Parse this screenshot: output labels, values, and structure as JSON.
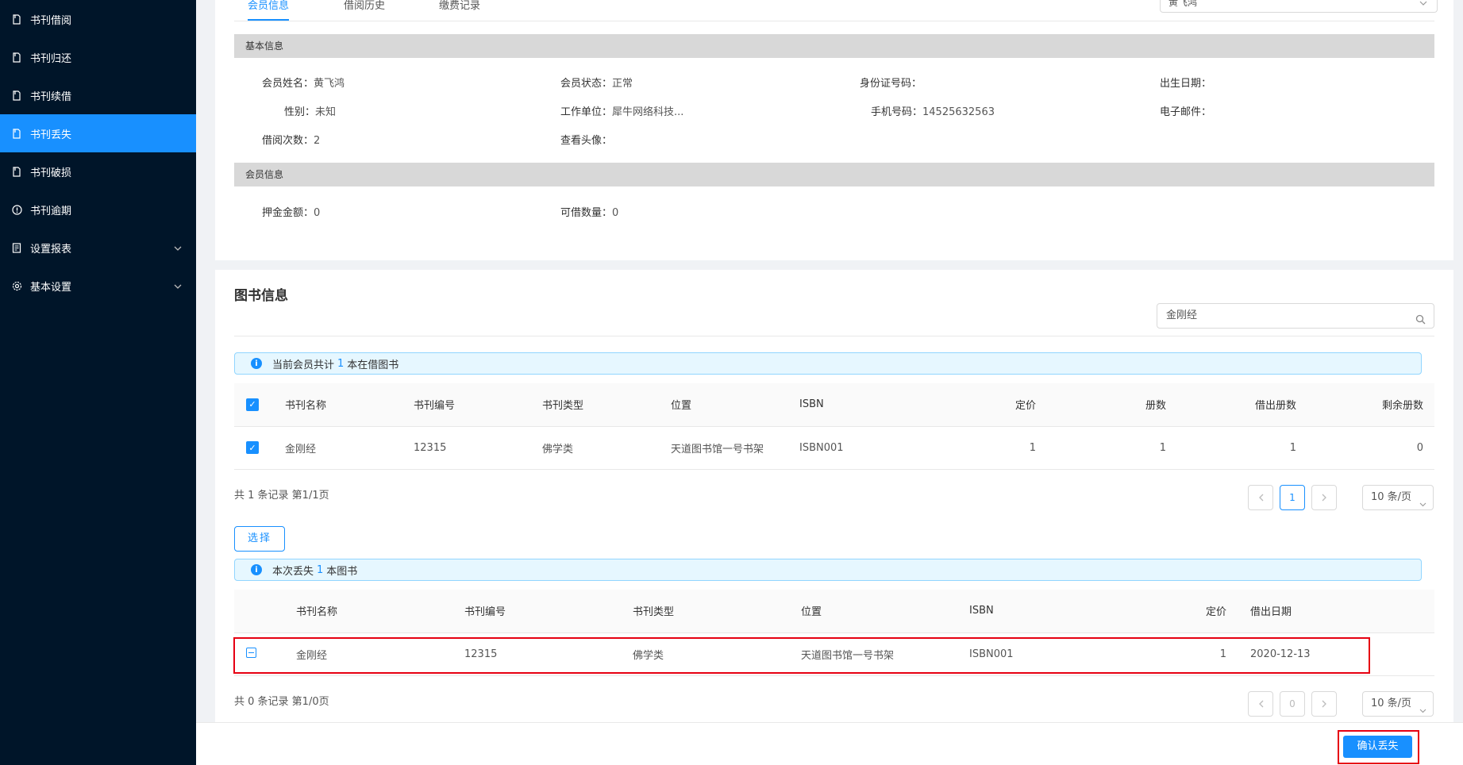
{
  "sidebar": {
    "items": [
      {
        "label": "书刊借阅",
        "icon": "file-icon"
      },
      {
        "label": "书刊归还",
        "icon": "file-icon"
      },
      {
        "label": "书刊续借",
        "icon": "file-icon"
      },
      {
        "label": "书刊丢失",
        "icon": "file-icon",
        "active": true
      },
      {
        "label": "书刊破损",
        "icon": "file-icon"
      },
      {
        "label": "书刊逾期",
        "icon": "exclamation-circle-icon"
      },
      {
        "label": "设置报表",
        "icon": "report-icon",
        "expandable": true
      },
      {
        "label": "基本设置",
        "icon": "gear-icon",
        "expandable": true
      }
    ]
  },
  "tabs": [
    "会员信息",
    "借阅历史",
    "缴费记录"
  ],
  "member_select": {
    "value": "黄飞鸿"
  },
  "basic_info": {
    "title": "基本信息",
    "name_label": "会员姓名：",
    "name": "黄飞鸿",
    "status_label": "会员状态：",
    "status": "正常",
    "id_label": "身份证号码：",
    "id": "",
    "birth_label": "出生日期：",
    "birth": "",
    "gender_label": "性别：",
    "gender": "未知",
    "work_label": "工作单位：",
    "work": "犀牛网络科技...",
    "phone_label": "手机号码：",
    "phone": "14525632563",
    "email_label": "电子邮件：",
    "email": "",
    "borrow_count_label": "借阅次数：",
    "borrow_count": "2",
    "avatar_label": "查看头像：",
    "avatar": ""
  },
  "member_info": {
    "title": "会员信息",
    "deposit_label": "押金金额：",
    "deposit": "0",
    "quota_label": "可借数量：",
    "quota": "0"
  },
  "books": {
    "title": "图书信息",
    "search_value": "金刚经",
    "alert_prefix": "当前会员共计",
    "alert_count": "1",
    "alert_suffix": "本在借图书",
    "columns": [
      "书刊名称",
      "书刊编号",
      "书刊类型",
      "位置",
      "ISBN",
      "定价",
      "册数",
      "借出册数",
      "剩余册数"
    ],
    "rows": [
      {
        "name": "金刚经",
        "code": "12315",
        "type": "佛学类",
        "location": "天道图书馆一号书架",
        "isbn": "ISBN001",
        "price": "1",
        "copies": "1",
        "lent": "1",
        "remain": "0"
      }
    ],
    "total_text": "共 1 条记录 第1/1页",
    "page": "1",
    "page_size": "10 条/页"
  },
  "select_button": "选择",
  "lost": {
    "alert_prefix": "本次丢失",
    "alert_count": "1",
    "alert_suffix": "本图书",
    "columns": [
      "书刊名称",
      "书刊编号",
      "书刊类型",
      "位置",
      "ISBN",
      "定价",
      "借出日期"
    ],
    "rows": [
      {
        "name": "金刚经",
        "code": "12315",
        "type": "佛学类",
        "location": "天道图书馆一号书架",
        "isbn": "ISBN001",
        "price": "1",
        "date": "2020-12-13"
      }
    ],
    "total_text": "共 0 条记录 第1/0页",
    "page": "0",
    "page_size": "10 条/页"
  },
  "confirm_button": "确认丢失",
  "colors": {
    "primary": "#1890ff",
    "sidebar": "#001529",
    "highlight": "#e60012"
  }
}
